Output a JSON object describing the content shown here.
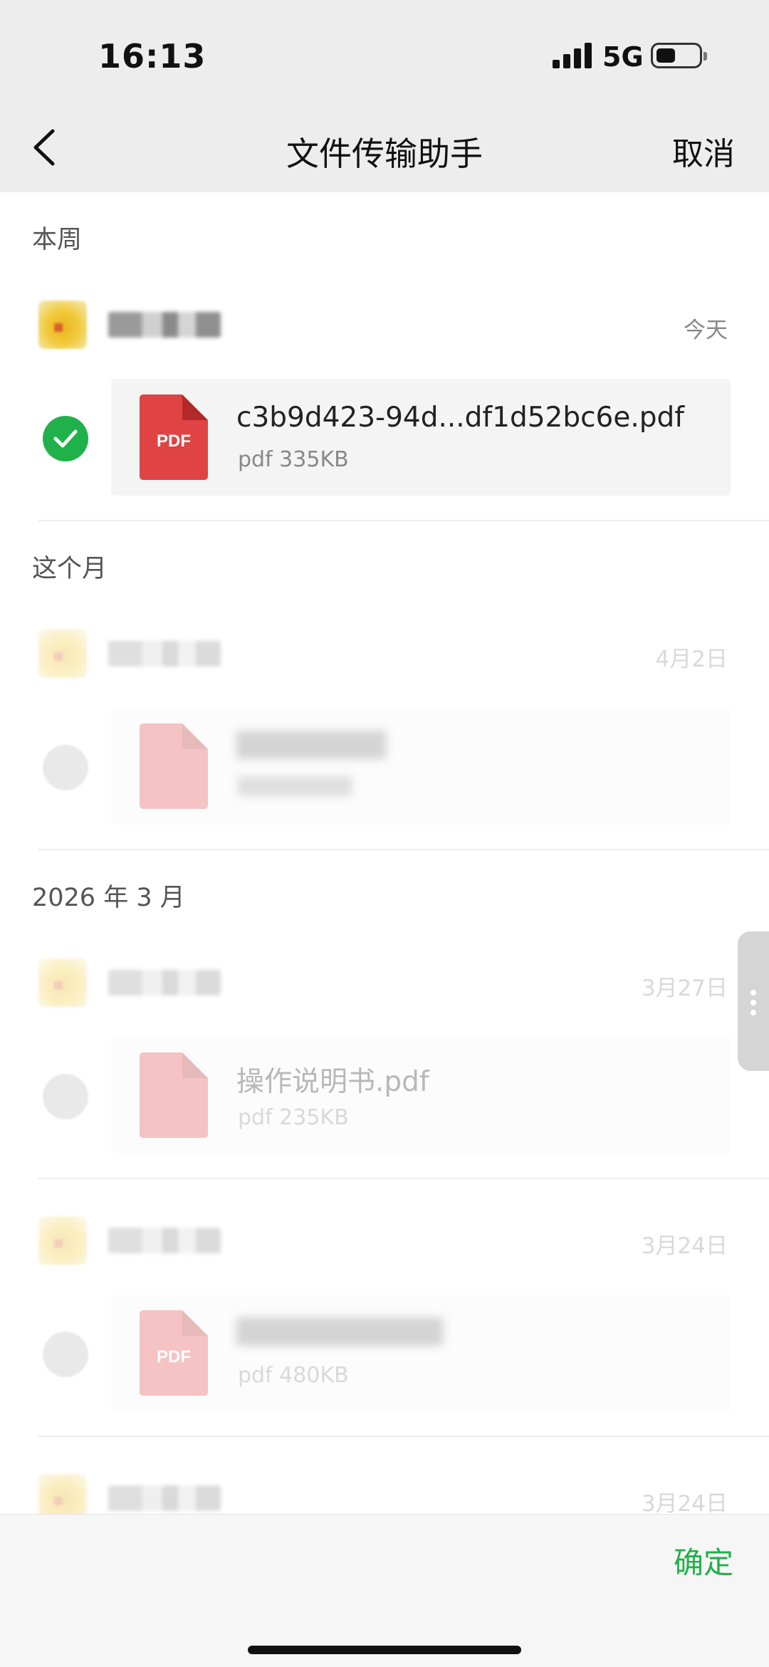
{
  "status_bar": {
    "time": "16:13",
    "network": "5G"
  },
  "header": {
    "title": "文件传输助手",
    "back_icon": "chevron-left-icon",
    "cancel_label": "取消"
  },
  "sections": [
    {
      "label": "本周"
    },
    {
      "label": "这个月"
    },
    {
      "label": "2026 年 3 月"
    }
  ],
  "items": [
    {
      "date": "今天",
      "file_icon_label": "PDF",
      "file_name": "c3b9d423-94d...df1d52bc6e.pdf",
      "file_meta": "pdf 335KB",
      "selected": true
    },
    {
      "date": "4月2日",
      "file_icon_label": "",
      "file_name": "",
      "file_meta": "",
      "selected": false
    },
    {
      "date": "3月27日",
      "file_icon_label": "",
      "file_name": "操作说明书.pdf",
      "file_meta": "pdf 235KB",
      "selected": false
    },
    {
      "date": "3月24日",
      "file_icon_label": "PDF",
      "file_name": "",
      "file_meta": "pdf 480KB",
      "selected": false
    },
    {
      "date": "3月24日"
    }
  ],
  "footer": {
    "confirm_label": "确定"
  },
  "colors": {
    "accent_green": "#21b14b",
    "pdf_red": "#df4343",
    "header_bg": "#ededed"
  }
}
